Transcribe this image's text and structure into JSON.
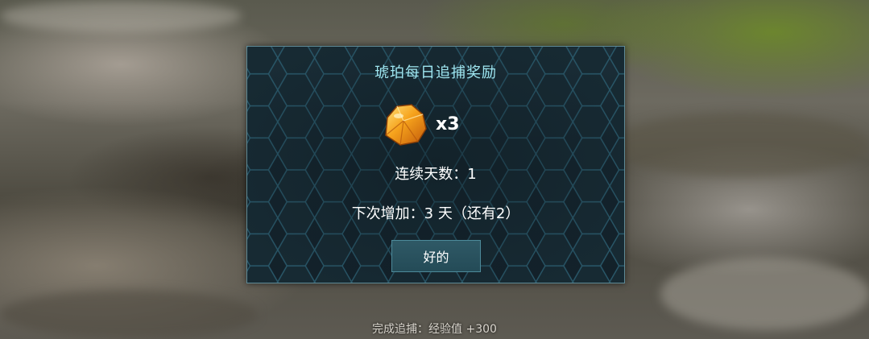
{
  "dialog": {
    "title": "琥珀每日追捕奖励",
    "reward": {
      "icon": "amber-icon",
      "quantity": "x3"
    },
    "streak_text": "连续天数：1",
    "next_increase_text": "下次增加：3 天（还有2）",
    "ok_label": "好的"
  },
  "status_bar": {
    "text": "完成追捕：经验值 +300"
  },
  "colors": {
    "title": "#9fe6f0",
    "panel_border": "#5f8a96",
    "panel_bg": "#14242d",
    "hex_line": "#2a5a6c",
    "button_bg": "#2a5260",
    "amber": "#f0a020"
  }
}
